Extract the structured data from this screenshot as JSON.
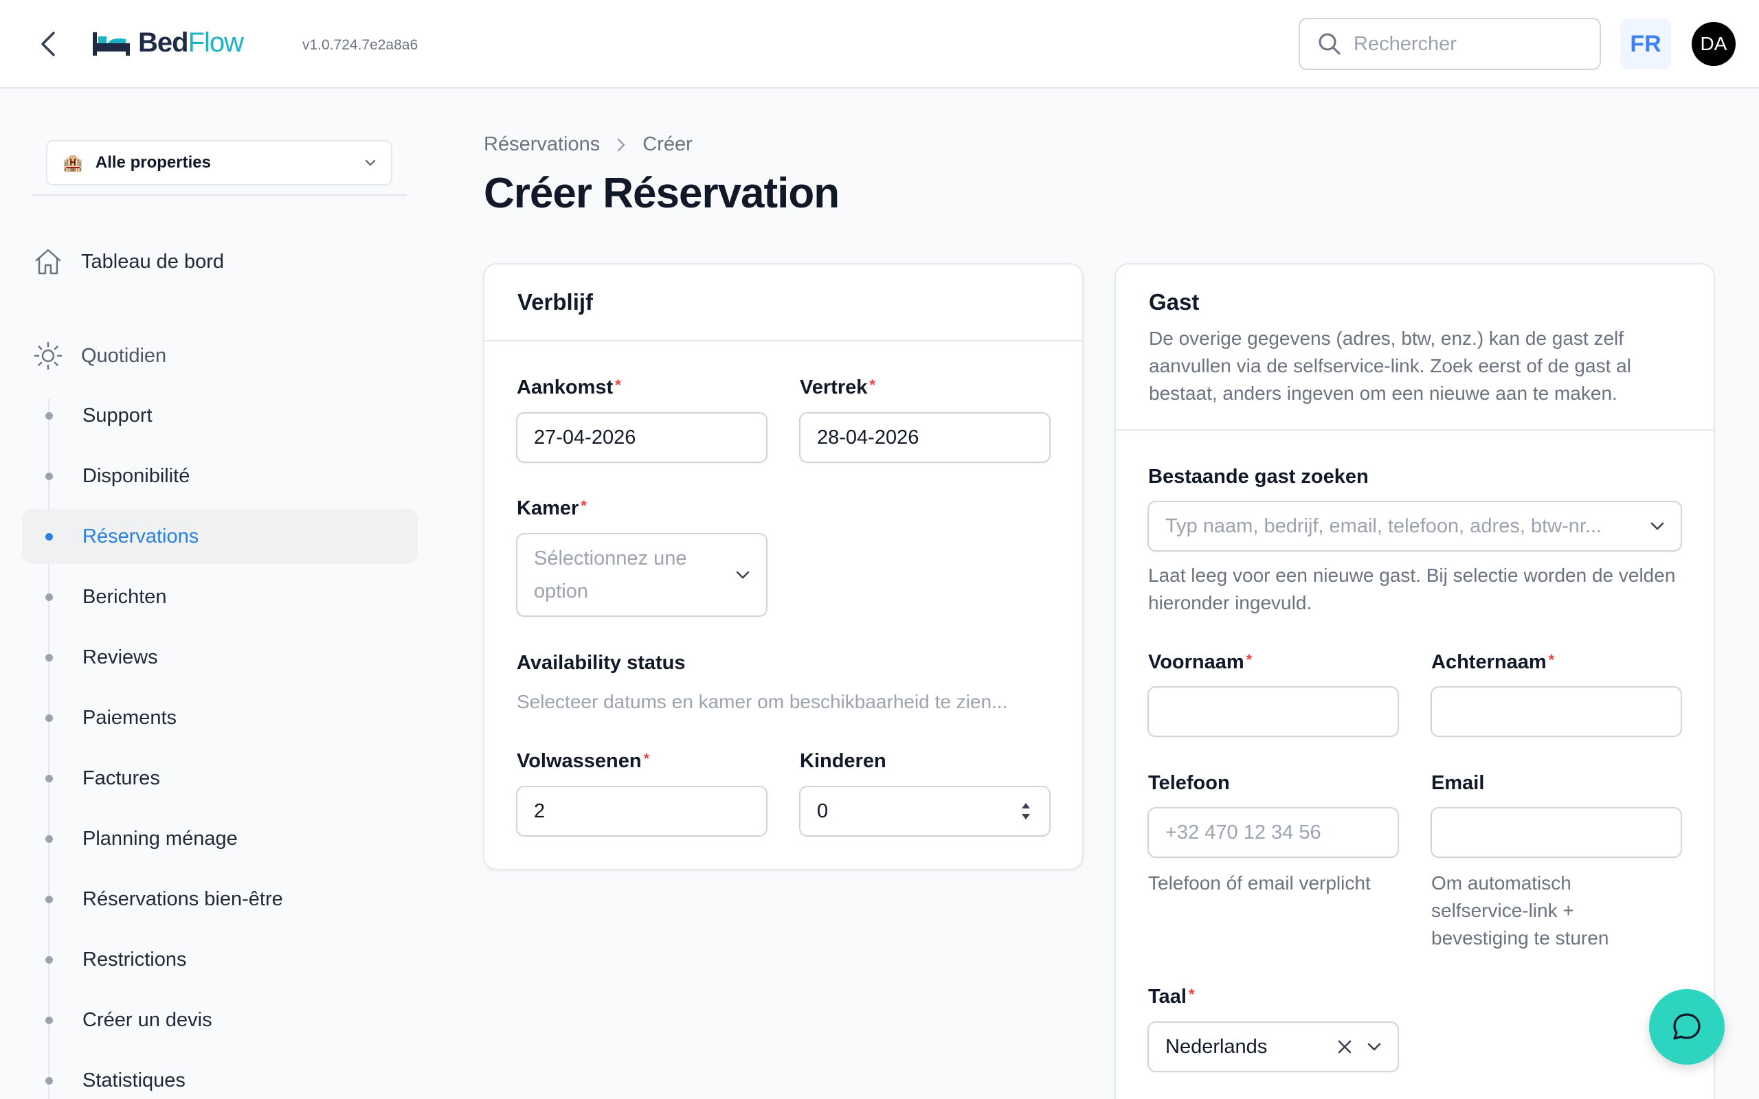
{
  "app": {
    "logo_bed": "Bed",
    "logo_flow": "Flow",
    "version": "v1.0.724.7e2a8a6",
    "lang": "FR",
    "avatar_initials": "DA",
    "search_placeholder": "Rechercher"
  },
  "sidebar": {
    "property_select": "Alle properties",
    "dashboard": "Tableau de bord",
    "section": "Quotidien",
    "items": [
      {
        "label": "Support"
      },
      {
        "label": "Disponibilité"
      },
      {
        "label": "Réservations",
        "active": true
      },
      {
        "label": "Berichten"
      },
      {
        "label": "Reviews"
      },
      {
        "label": "Paiements"
      },
      {
        "label": "Factures"
      },
      {
        "label": "Planning ménage"
      },
      {
        "label": "Réservations bien-être"
      },
      {
        "label": "Restrictions"
      },
      {
        "label": "Créer un devis"
      },
      {
        "label": "Statistiques"
      }
    ]
  },
  "breadcrumb": {
    "parent": "Réservations",
    "current": "Créer"
  },
  "page_title": "Créer Réservation",
  "stay": {
    "title": "Verblijf",
    "arrival_label": "Aankomst",
    "arrival_value": "27-04-2026",
    "departure_label": "Vertrek",
    "departure_value": "28-04-2026",
    "room_label": "Kamer",
    "room_placeholder_1": "Sélectionnez une",
    "room_placeholder_2": "option",
    "availability_label": "Availability status",
    "availability_text": "Selecteer datums en kamer om beschikbaarheid te zien...",
    "adults_label": "Volwassenen",
    "adults_value": "2",
    "children_label": "Kinderen",
    "children_value": "0"
  },
  "guest": {
    "title": "Gast",
    "desc": "De overige gegevens (adres, btw, enz.) kan de gast zelf aanvullen via de selfservice-link. Zoek eerst of de gast al bestaat, anders ingeven om een nieuwe aan te maken.",
    "search_label": "Bestaande gast zoeken",
    "search_placeholder": "Typ naam, bedrijf, email, telefoon, adres, btw-nr...",
    "search_help": "Laat leeg voor een nieuwe gast. Bij selectie worden de velden hieronder ingevuld.",
    "firstname_label": "Voornaam",
    "lastname_label": "Achternaam",
    "phone_label": "Telefoon",
    "phone_placeholder": "+32 470 12 34 56",
    "phone_help": "Telefoon óf email verplicht",
    "email_label": "Email",
    "email_help": "Om automatisch selfservice-link + bevestiging te sturen",
    "language_label": "Taal",
    "language_value": "Nederlands"
  },
  "colors": {
    "accent": "#2b7fe0",
    "brand_teal": "#1ab3c4",
    "chat": "#2dd4bf",
    "required": "#ef4444"
  }
}
